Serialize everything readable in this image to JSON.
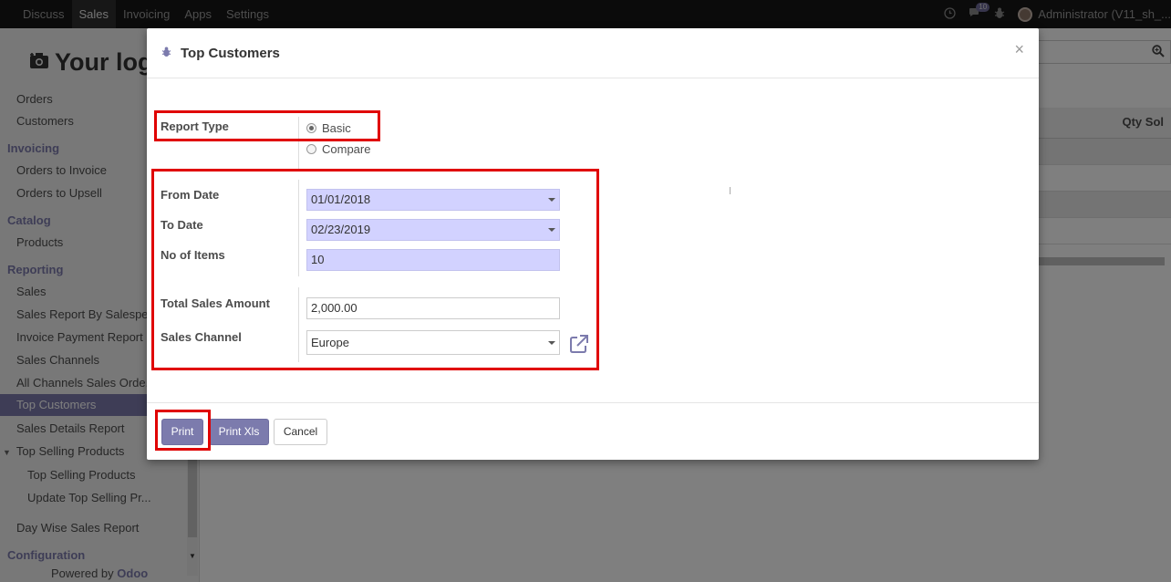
{
  "topbar": {
    "menu": [
      "Discuss",
      "Sales",
      "Invoicing",
      "Apps",
      "Settings"
    ],
    "active": "Sales",
    "chat_count": "10",
    "user": "Administrator (V11_sh_..."
  },
  "sidebar": {
    "logo_text": "Your log",
    "items": {
      "orders": "Orders",
      "customers": "Customers",
      "invoicing_head": "Invoicing",
      "orders_to_invoice": "Orders to Invoice",
      "orders_to_upsell": "Orders to Upsell",
      "catalog_head": "Catalog",
      "products": "Products",
      "reporting_head": "Reporting",
      "sales": "Sales",
      "sales_report_salesperson": "Sales Report By Salespe...",
      "invoice_payment_report": "Invoice Payment Report",
      "sales_channels": "Sales Channels",
      "all_channels_sales_orders": "All Channels Sales Orde...",
      "top_customers": "Top Customers",
      "sales_details_report": "Sales Details Report",
      "top_selling_products_parent": "Top Selling Products",
      "top_selling_products": "Top Selling Products",
      "update_top_selling": "Update Top Selling Pr...",
      "day_wise_sales_report": "Day Wise Sales Report",
      "configuration_head": "Configuration"
    },
    "powered_by": "Powered by",
    "powered_brand": "Odoo"
  },
  "background": {
    "column_header": "Qty Sol"
  },
  "modal": {
    "title": "Top Customers",
    "close": "×",
    "report_type_label": "Report Type",
    "report_type_options": [
      "Basic",
      "Compare"
    ],
    "report_type_selected": "Basic",
    "from_date_label": "From Date",
    "from_date": "01/01/2018",
    "to_date_label": "To Date",
    "to_date": "02/23/2019",
    "no_items_label": "No of Items",
    "no_items": "10",
    "total_sales_label": "Total Sales Amount",
    "total_sales": "2,000.00",
    "sales_channel_label": "Sales Channel",
    "sales_channel": "Europe",
    "buttons": {
      "print": "Print",
      "print_xls": "Print Xls",
      "cancel": "Cancel"
    }
  },
  "colors": {
    "accent": "#7c7bad",
    "required_field": "#d2d2ff",
    "highlight": "#e00000"
  }
}
